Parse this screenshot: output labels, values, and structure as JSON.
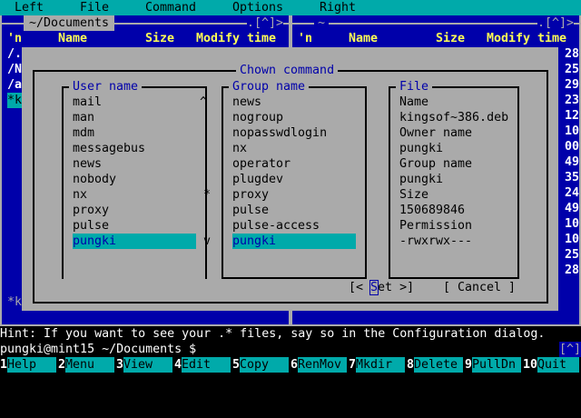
{
  "menu": [
    "Left",
    "File",
    "Command",
    "Options",
    "Right"
  ],
  "left_panel": {
    "path": "~/Documents",
    "corner": ".[^]>",
    "columns": [
      "'n",
      "Name",
      "Size",
      "Modify time"
    ],
    "rows": [
      "/.",
      "/N",
      "/a",
      "*k"
    ],
    "bottom": "*k"
  },
  "right_panel": {
    "path": "~",
    "corner": ".[^]>",
    "columns": [
      "'n",
      "Name",
      "Size",
      "Modify time"
    ],
    "times": [
      "28",
      "25",
      "29",
      "23",
      "12",
      "10",
      "00",
      "49",
      "35",
      "24",
      "49",
      "10",
      "10",
      "25",
      "28"
    ]
  },
  "dialog": {
    "title": "Chown command",
    "user": {
      "label": "User name",
      "items": [
        "mail",
        "man",
        "mdm",
        "messagebus",
        "news",
        "nobody",
        "nx",
        "proxy",
        "pulse",
        "pungki"
      ],
      "selected": "pungki",
      "scroll_up": "^",
      "scroll_thumb": "*",
      "scroll_down": "v"
    },
    "group": {
      "label": "Group name",
      "items": [
        "news",
        "nogroup",
        "nopasswdlogin",
        "nx",
        "operator",
        "plugdev",
        "proxy",
        "pulse",
        "pulse-access",
        "pungki"
      ],
      "selected": "pungki"
    },
    "file": {
      "label": "File",
      "lines": [
        "Name",
        "kingsof~386.deb",
        "Owner name",
        "pungki",
        "Group name",
        "pungki",
        "Size",
        "150689846",
        "Permission",
        "-rwxrwx---"
      ]
    },
    "set_button": {
      "pre": "[< ",
      "hot": "S",
      "post": "et >]"
    },
    "cancel_button": "[ Cancel ]"
  },
  "hint": "Hint: If you want to see your .* files, say so in the Configuration dialog.",
  "prompt": "pungki@mint15 ~/Documents $",
  "prompt_corner": "[^]",
  "fkeys": [
    {
      "n": "1",
      "l": "Help"
    },
    {
      "n": "2",
      "l": "Menu"
    },
    {
      "n": "3",
      "l": "View"
    },
    {
      "n": "4",
      "l": "Edit"
    },
    {
      "n": "5",
      "l": "Copy"
    },
    {
      "n": "6",
      "l": "RenMov"
    },
    {
      "n": "7",
      "l": "Mkdir"
    },
    {
      "n": "8",
      "l": "Delete"
    },
    {
      "n": "9",
      "l": "PullDn"
    },
    {
      "n": "10",
      "l": "Quit"
    }
  ]
}
